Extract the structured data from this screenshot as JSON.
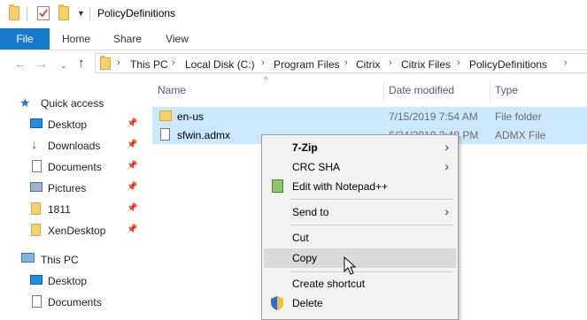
{
  "window": {
    "title": "PolicyDefinitions"
  },
  "ribbon": {
    "tabs": [
      "File",
      "Home",
      "Share",
      "View"
    ]
  },
  "breadcrumb": [
    "This PC",
    "Local Disk (C:)",
    "Program Files",
    "Citrix",
    "Citrix Files",
    "PolicyDefinitions"
  ],
  "nav": {
    "items": [
      {
        "label": "Quick access",
        "icon": "star-icon"
      },
      {
        "label": "Desktop",
        "icon": "desktop-icon",
        "pinned": true
      },
      {
        "label": "Downloads",
        "icon": "downloads-icon",
        "pinned": true
      },
      {
        "label": "Documents",
        "icon": "documents-icon",
        "pinned": true
      },
      {
        "label": "Pictures",
        "icon": "pictures-icon",
        "pinned": true
      },
      {
        "label": "1811",
        "icon": "folder-icon",
        "pinned": true
      },
      {
        "label": "XenDesktop",
        "icon": "folder-icon",
        "pinned": true
      },
      {
        "label": "This PC",
        "icon": "computer-icon"
      },
      {
        "label": "Desktop",
        "icon": "desktop-icon"
      },
      {
        "label": "Documents",
        "icon": "documents-icon"
      }
    ]
  },
  "columns": {
    "name": "Name",
    "date": "Date modified",
    "type": "Type"
  },
  "files": [
    {
      "name": "en-us",
      "date": "7/15/2019 7:54 AM",
      "type": "File folder"
    },
    {
      "name": "sfwin.admx",
      "date": "6/24/2019 2:48 PM",
      "type": "ADMX File"
    }
  ],
  "context_menu": {
    "items": [
      "7-Zip",
      "CRC SHA",
      "Edit with Notepad++",
      "Send to",
      "Cut",
      "Copy",
      "Create shortcut",
      "Delete"
    ],
    "highlighted": "Copy"
  },
  "colors": {
    "accent": "#1979ca",
    "selection": "#cce8ff",
    "menu_hover": "#dadada"
  }
}
